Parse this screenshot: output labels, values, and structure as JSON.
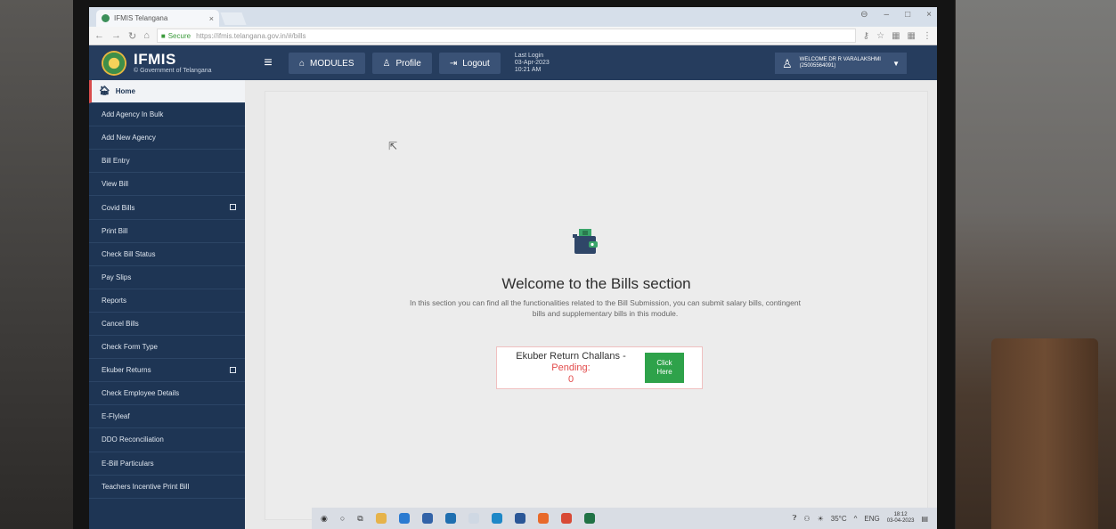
{
  "browser": {
    "tab_title": "IFMIS Telangana",
    "tab_close": "×",
    "address_secure": "Secure",
    "address_url": "https://ifmis.telangana.gov.in/#/bills",
    "window_controls": [
      "⊖",
      "–",
      "□",
      "×"
    ]
  },
  "header": {
    "brand_name": "IFMIS",
    "brand_sub": "© Government of Telangana",
    "modules_label": "MODULES",
    "profile_label": "Profile",
    "logout_label": "Logout",
    "last_login_label": "Last Login",
    "last_login_date": "03-Apr-2023",
    "last_login_time": "10:21 AM",
    "welcome_line1": "WELCOME DR R VARALAKSHMI",
    "welcome_line2": "(25005564091)"
  },
  "sidebar": {
    "items": [
      {
        "label": "Home"
      },
      {
        "label": "Add Agency In Bulk"
      },
      {
        "label": "Add New Agency"
      },
      {
        "label": "Bill Entry"
      },
      {
        "label": "View Bill"
      },
      {
        "label": "Covid Bills"
      },
      {
        "label": "Print Bill"
      },
      {
        "label": "Check Bill Status"
      },
      {
        "label": "Pay Slips"
      },
      {
        "label": "Reports"
      },
      {
        "label": "Cancel Bills"
      },
      {
        "label": "Check Form Type"
      },
      {
        "label": "Ekuber Returns"
      },
      {
        "label": "Check Employee Details"
      },
      {
        "label": "E-Flyleaf"
      },
      {
        "label": "DDO Reconciliation"
      },
      {
        "label": "E-Bill Particulars"
      },
      {
        "label": "Teachers Incentive Print Bill"
      }
    ]
  },
  "main": {
    "title": "Welcome to the Bills section",
    "description": "In this section you can find all the functionalities related to the Bill Submission, you can submit salary bills, contingent bills and supplementary bills in this module.",
    "ekuber_label": "Ekuber Return Challans - ",
    "ekuber_pending": "Pending:",
    "ekuber_count": "0",
    "click_line1": "Click",
    "click_line2": "Here"
  },
  "taskbar": {
    "temperature": "35°C",
    "language": "ENG",
    "time": "18:12",
    "date": "03-04-2023"
  },
  "colors": {
    "header_bg": "#263d5e",
    "sidebar_bg": "#1e3554",
    "pending_red": "#e24b4b",
    "click_green": "#2ea24a"
  }
}
